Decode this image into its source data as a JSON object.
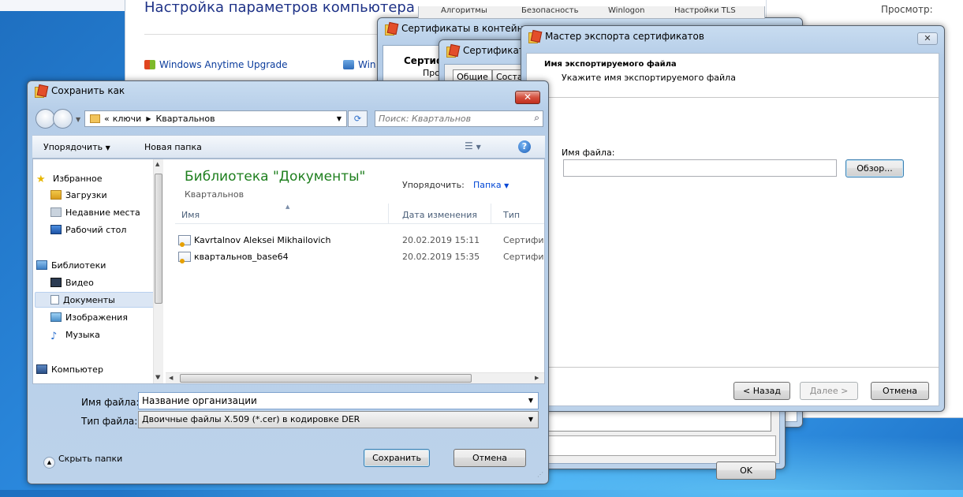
{
  "bg_panel": {
    "heading": "Настройка параметров компьютера",
    "anytime_upgrade": "Windows Anytime Upgrade",
    "right_fragment": "Win",
    "view_label": "Просмотр:"
  },
  "cert_container_window": {
    "title": "Сертификаты в контейнере",
    "tabs": [
      "Алгоритмы",
      "Безопасность",
      "Winlogon",
      "Настройки TLS"
    ],
    "subtitle": "Сертиф",
    "line2": "Про"
  },
  "cert_window": {
    "title": "Сертификат",
    "tab_general": "Общие",
    "tab_composition": "Соста",
    "ok_label": "OK"
  },
  "export_wizard": {
    "title": "Мастер экспорта сертификатов",
    "heading": "Имя экспортируемого файла",
    "subheading": "Укажите имя экспортируемого файла",
    "file_name_label": "Имя файла:",
    "file_name_value": "",
    "browse_label": "Обзор...",
    "back_label": "< Назад",
    "next_label": "Далее >",
    "cancel_label": "Отмена"
  },
  "save_dialog": {
    "title": "Сохранить как",
    "breadcrumb": {
      "prefix": "«",
      "folder1": "ключи",
      "folder2": "Квартальнов"
    },
    "search_placeholder": "Поиск: Квартальнов",
    "toolbar": {
      "organize": "Упорядочить",
      "new_folder": "Новая папка"
    },
    "nav": {
      "favorites": "Избранное",
      "downloads": "Загрузки",
      "recent": "Недавние места",
      "desktop": "Рабочий стол",
      "libraries": "Библиотеки",
      "video": "Видео",
      "documents": "Документы",
      "images": "Изображения",
      "music": "Музыка",
      "computer": "Компьютер"
    },
    "library": {
      "title": "Библиотека \"Документы\"",
      "subtitle": "Квартальнов",
      "arrange_label": "Упорядочить:",
      "arrange_value": "Папка"
    },
    "columns": {
      "name": "Имя",
      "date": "Дата изменения",
      "type": "Тип"
    },
    "files": [
      {
        "name": "Kavrtalnov Aleksei Mikhailovich",
        "date": "20.02.2019 15:11",
        "type": "Сертифи"
      },
      {
        "name": "квартальнов_base64",
        "date": "20.02.2019 15:35",
        "type": "Сертифи"
      }
    ],
    "file_name_label": "Имя файла:",
    "file_name_value": "Название организации",
    "file_type_label": "Тип файла:",
    "file_type_value": "Двоичные файлы X.509 (*.cer) в кодировке DER",
    "hide_folders": "Скрыть папки",
    "save_label": "Сохранить",
    "cancel_label": "Отмена"
  },
  "colors": {
    "library_title": "#1e7f1e",
    "link_blue": "#0046d5",
    "nav_selected": "#dbe6f4"
  }
}
